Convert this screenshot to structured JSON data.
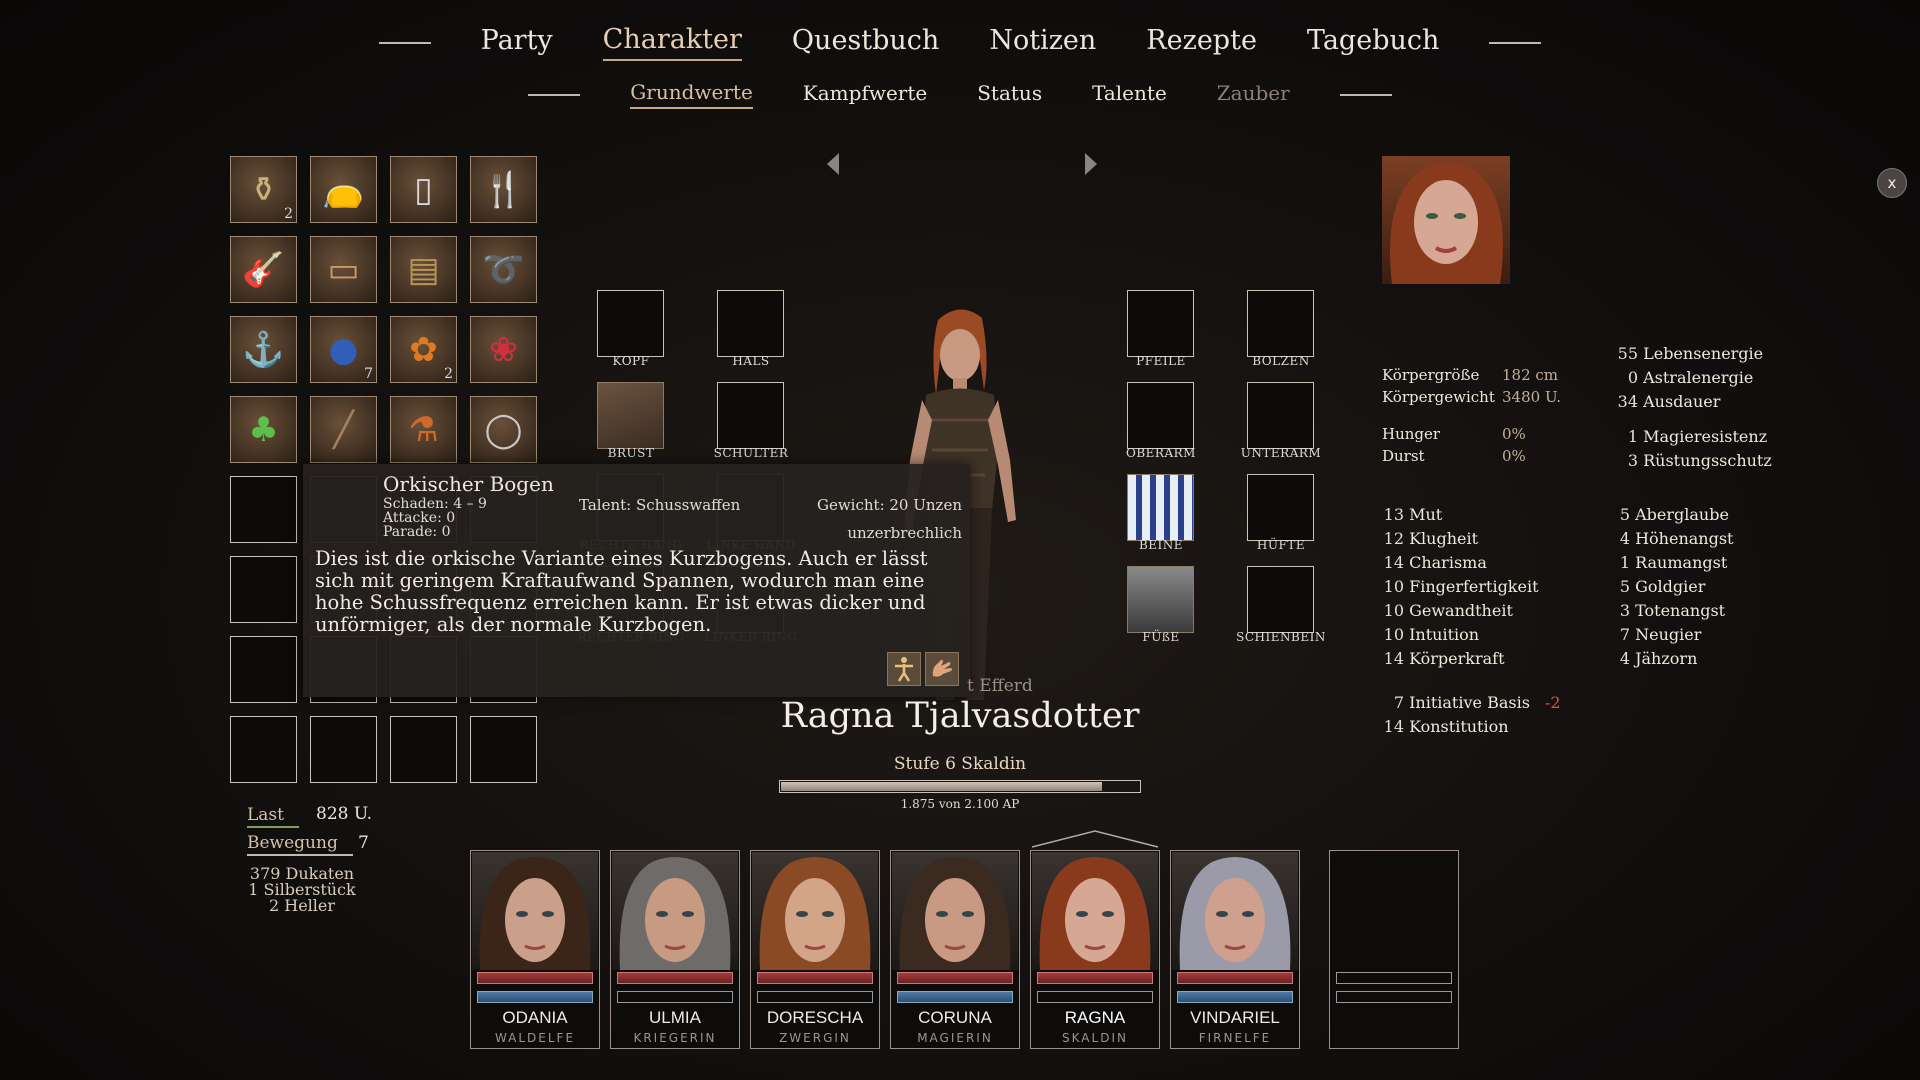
{
  "tabs_main": [
    "Party",
    "Charakter",
    "Questbuch",
    "Notizen",
    "Rezepte",
    "Tagebuch"
  ],
  "tabs_sub": [
    "Grundwerte",
    "Kampfwerte",
    "Status",
    "Talente",
    "Zauber"
  ],
  "close_label": "x",
  "inventory": {
    "counts": {
      "slot0": "2",
      "slot9": "7",
      "slot10": "2"
    },
    "last_label": "Last",
    "last_value": "828 U.",
    "bewegung_label": "Bewegung",
    "bewegung_value": "7",
    "money": [
      "379 Dukaten",
      "1 Silberstück",
      "2 Heller"
    ]
  },
  "equipment": {
    "kopf": "KOPF",
    "hals": "HALS",
    "brust": "BRUST",
    "schulter": "SCHULTER",
    "rechte_hand": "RECHTE HAND",
    "linke_hand": "LINKE HAND",
    "rechter_ring": "RECHTER RING",
    "linker_ring": "LINKER RING",
    "pfeile": "PFEILE",
    "bolzen": "BOLZEN",
    "oberarm": "OBERARM",
    "unterarm": "UNTERARM",
    "beine": "BEINE",
    "huefte": "HÜFTE",
    "fuesse": "FÜßE",
    "schienbein": "SCHIENBEIN"
  },
  "tooltip": {
    "title": "Orkischer Bogen",
    "schaden": "Schaden: 4 – 9",
    "attacke": "Attacke: 0",
    "parade": "Parade: 0",
    "talent": "Talent: Schusswaffen",
    "gewicht": "Gewicht: 20 Unzen",
    "unzerbrechlich": "unzerbrechlich",
    "description": "Dies ist die orkische Variante eines Kurzbogens. Auch er lässt sich mit geringem Kraftaufwand Spannen, wodurch man eine hohe Schussfrequenz erreichen kann. Er ist etwas dicker und unförmiger, als der normale Kurzbogen."
  },
  "character": {
    "origin_partial": "t Efferd",
    "name": "Ragna Tjalvasdotter",
    "level": "Stufe 6 Skaldin",
    "ap_text": "1.875 von 2.100 AP",
    "ap_progress": 0.893
  },
  "body": {
    "groesse_label": "Körpergröße",
    "groesse_value": "182 cm",
    "gewicht_label": "Körpergewicht",
    "gewicht_value": "3480 U.",
    "hunger_label": "Hunger",
    "hunger_value": "0%",
    "durst_label": "Durst",
    "durst_value": "0%"
  },
  "energies": [
    {
      "v": "55",
      "l": "Lebensenergie"
    },
    {
      "v": "0",
      "l": "Astralenergie"
    },
    {
      "v": "34",
      "l": "Ausdauer"
    },
    {
      "v": "1",
      "l": "Magieresistenz"
    },
    {
      "v": "3",
      "l": "Rüstungsschutz"
    }
  ],
  "attributes": [
    {
      "v": "13",
      "l": "Mut"
    },
    {
      "v": "12",
      "l": "Klugheit"
    },
    {
      "v": "14",
      "l": "Charisma"
    },
    {
      "v": "10",
      "l": "Fingerfertigkeit"
    },
    {
      "v": "10",
      "l": "Gewandtheit"
    },
    {
      "v": "10",
      "l": "Intuition"
    },
    {
      "v": "14",
      "l": "Körperkraft"
    }
  ],
  "negatives": [
    {
      "v": "5",
      "l": "Aberglaube"
    },
    {
      "v": "4",
      "l": "Höhenangst"
    },
    {
      "v": "1",
      "l": "Raumangst"
    },
    {
      "v": "5",
      "l": "Goldgier"
    },
    {
      "v": "3",
      "l": "Totenangst"
    },
    {
      "v": "7",
      "l": "Neugier"
    },
    {
      "v": "4",
      "l": "Jähzorn"
    }
  ],
  "initiative": {
    "v": "7",
    "l": "Initiative Basis",
    "mod": "-2"
  },
  "konstitution": {
    "v": "14",
    "l": "Konstitution"
  },
  "party": [
    {
      "name": "ODANIA",
      "role": "WALDELFE",
      "hp": 1,
      "mp": 1,
      "hair": "#3a2518",
      "skin": "#caa08a"
    },
    {
      "name": "ULMIA",
      "role": "KRIEGERIN",
      "hp": 1,
      "mp": 0,
      "hair": "#6f6b68",
      "skin": "#c79a82"
    },
    {
      "name": "DORESCHA",
      "role": "ZWERGIN",
      "hp": 1,
      "mp": 0,
      "hair": "#8a4a26",
      "skin": "#d2a589"
    },
    {
      "name": "CORUNA",
      "role": "MAGIERIN",
      "hp": 1,
      "mp": 1,
      "hair": "#3b2a1f",
      "skin": "#c89a83"
    },
    {
      "name": "RAGNA",
      "role": "SKALDIN",
      "hp": 1,
      "mp": 0,
      "hair": "#8a3a1c",
      "skin": "#d6a893"
    },
    {
      "name": "VINDARIEL",
      "role": "FIRNELFE",
      "hp": 1,
      "mp": 1,
      "hair": "#9a9aa8",
      "skin": "#cfa08e"
    }
  ]
}
